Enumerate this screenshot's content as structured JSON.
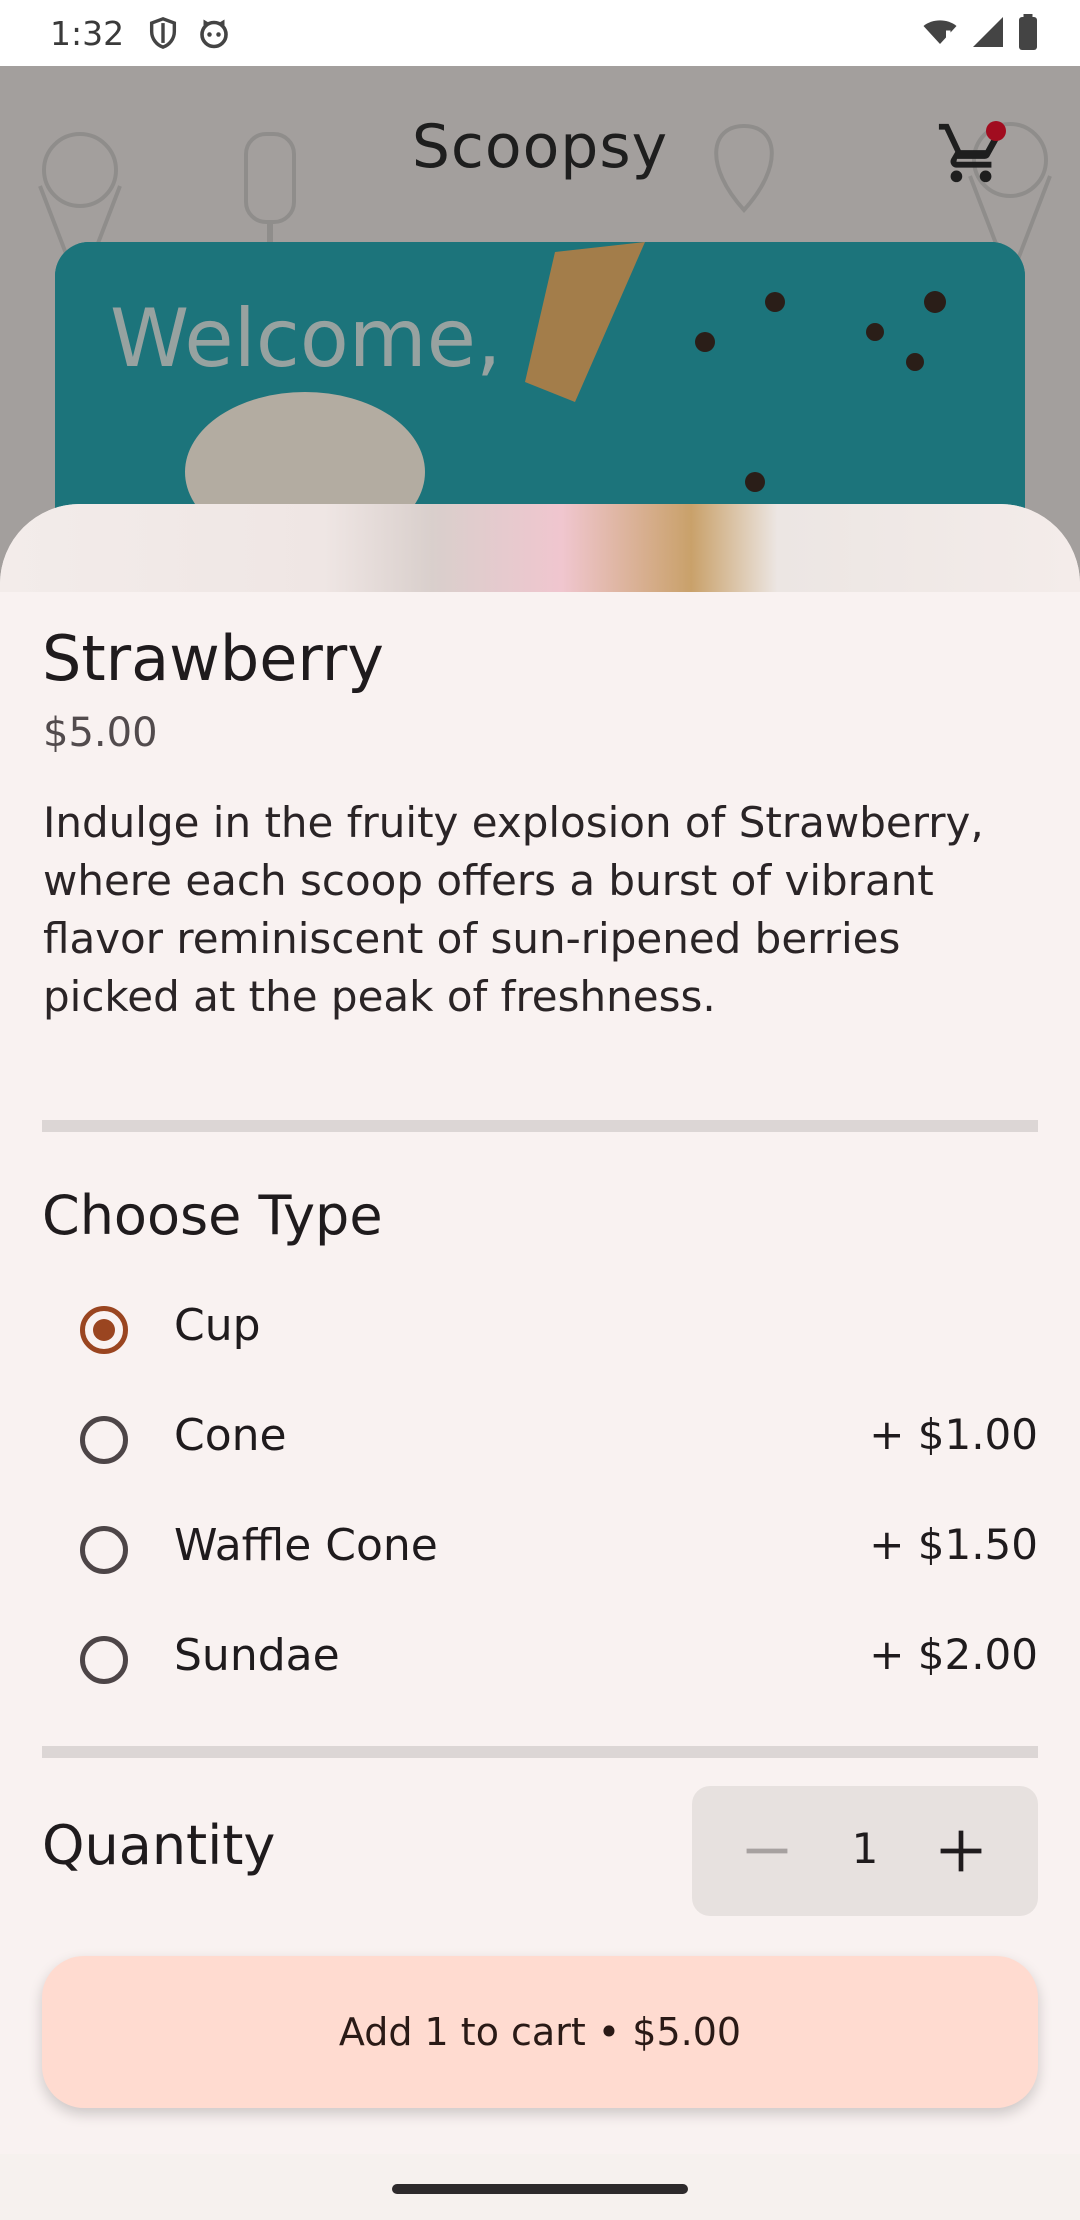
{
  "status_bar": {
    "time": "1:32",
    "icons": [
      "shield-icon",
      "cat-icon",
      "wifi-icon",
      "signal-icon",
      "battery-icon"
    ]
  },
  "app": {
    "title": "Scoopsy",
    "banner_text": "Welcome,",
    "cart_badge_color": "#d6001c"
  },
  "product": {
    "name": "Strawberry",
    "price": "$5.00",
    "description": "Indulge in the fruity explosion of Strawberry, where each scoop offers a burst of vibrant flavor reminiscent of sun-ripened berries picked at the peak of freshness."
  },
  "type_section": {
    "title": "Choose Type",
    "options": [
      {
        "label": "Cup",
        "price": "",
        "selected": true
      },
      {
        "label": "Cone",
        "price": "+ $1.00",
        "selected": false
      },
      {
        "label": "Waffle Cone",
        "price": "+ $1.50",
        "selected": false
      },
      {
        "label": "Sundae",
        "price": "+ $2.00",
        "selected": false
      }
    ]
  },
  "quantity": {
    "label": "Quantity",
    "value": "1"
  },
  "add_button": {
    "label": "Add 1 to cart • $5.00"
  },
  "colors": {
    "accent": "#9a4520",
    "button_bg": "#ffdbd0",
    "sheet_bg": "#f9f2f1"
  }
}
